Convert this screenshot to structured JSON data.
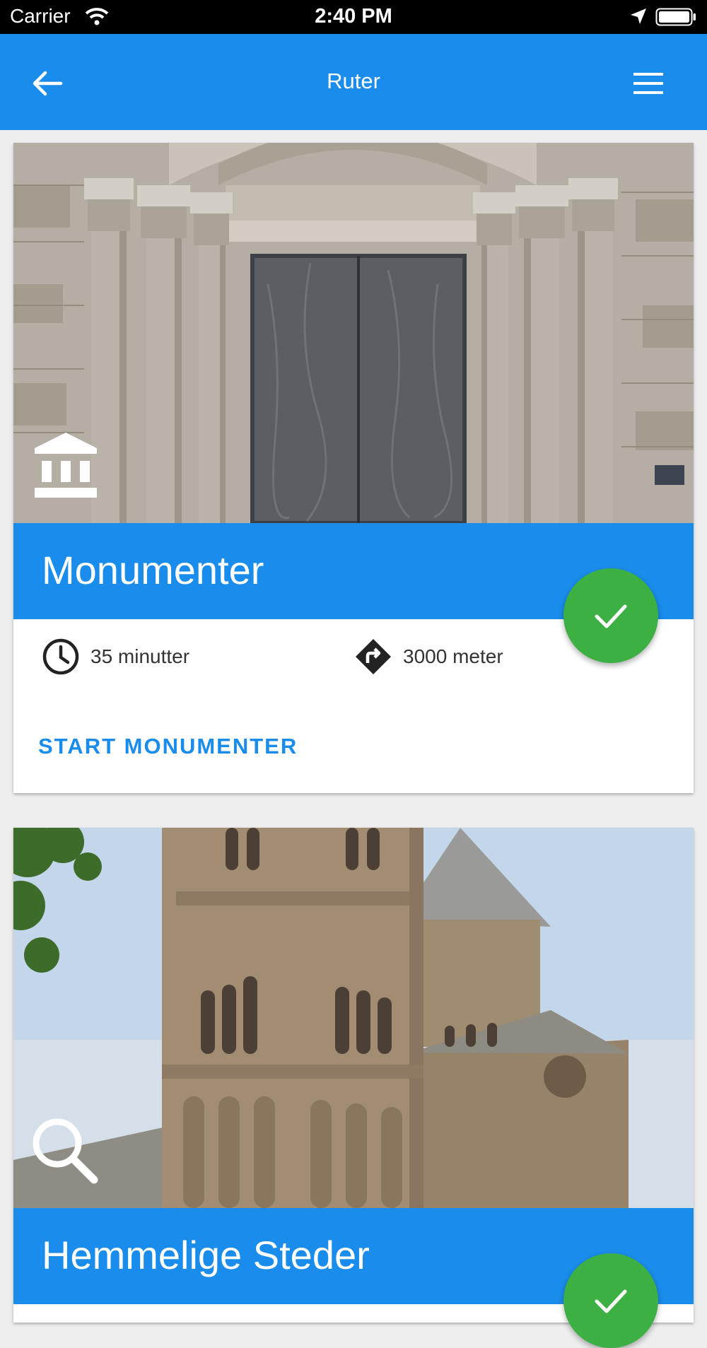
{
  "status_bar": {
    "carrier": "Carrier",
    "time": "2:40 PM",
    "icons": [
      "wifi-icon",
      "location-arrow-icon",
      "battery-icon"
    ]
  },
  "app_bar": {
    "title": "Ruter",
    "back_icon": "arrow-left-icon",
    "menu_icon": "hamburger-menu-icon"
  },
  "routes": [
    {
      "name": "Monumenter",
      "category_icon": "museum-icon",
      "photo": "cathedral-door-photo",
      "completed": true,
      "duration": "35 minutter",
      "distance": "3000 meter",
      "start_label": "START MONUMENTER"
    },
    {
      "name": "Hemmelige Steder",
      "category_icon": "search-icon",
      "photo": "church-towers-photo",
      "completed": true
    }
  ],
  "colors": {
    "primary": "#1a8ceb",
    "success": "#3cb043",
    "status_bar": "#000000"
  }
}
